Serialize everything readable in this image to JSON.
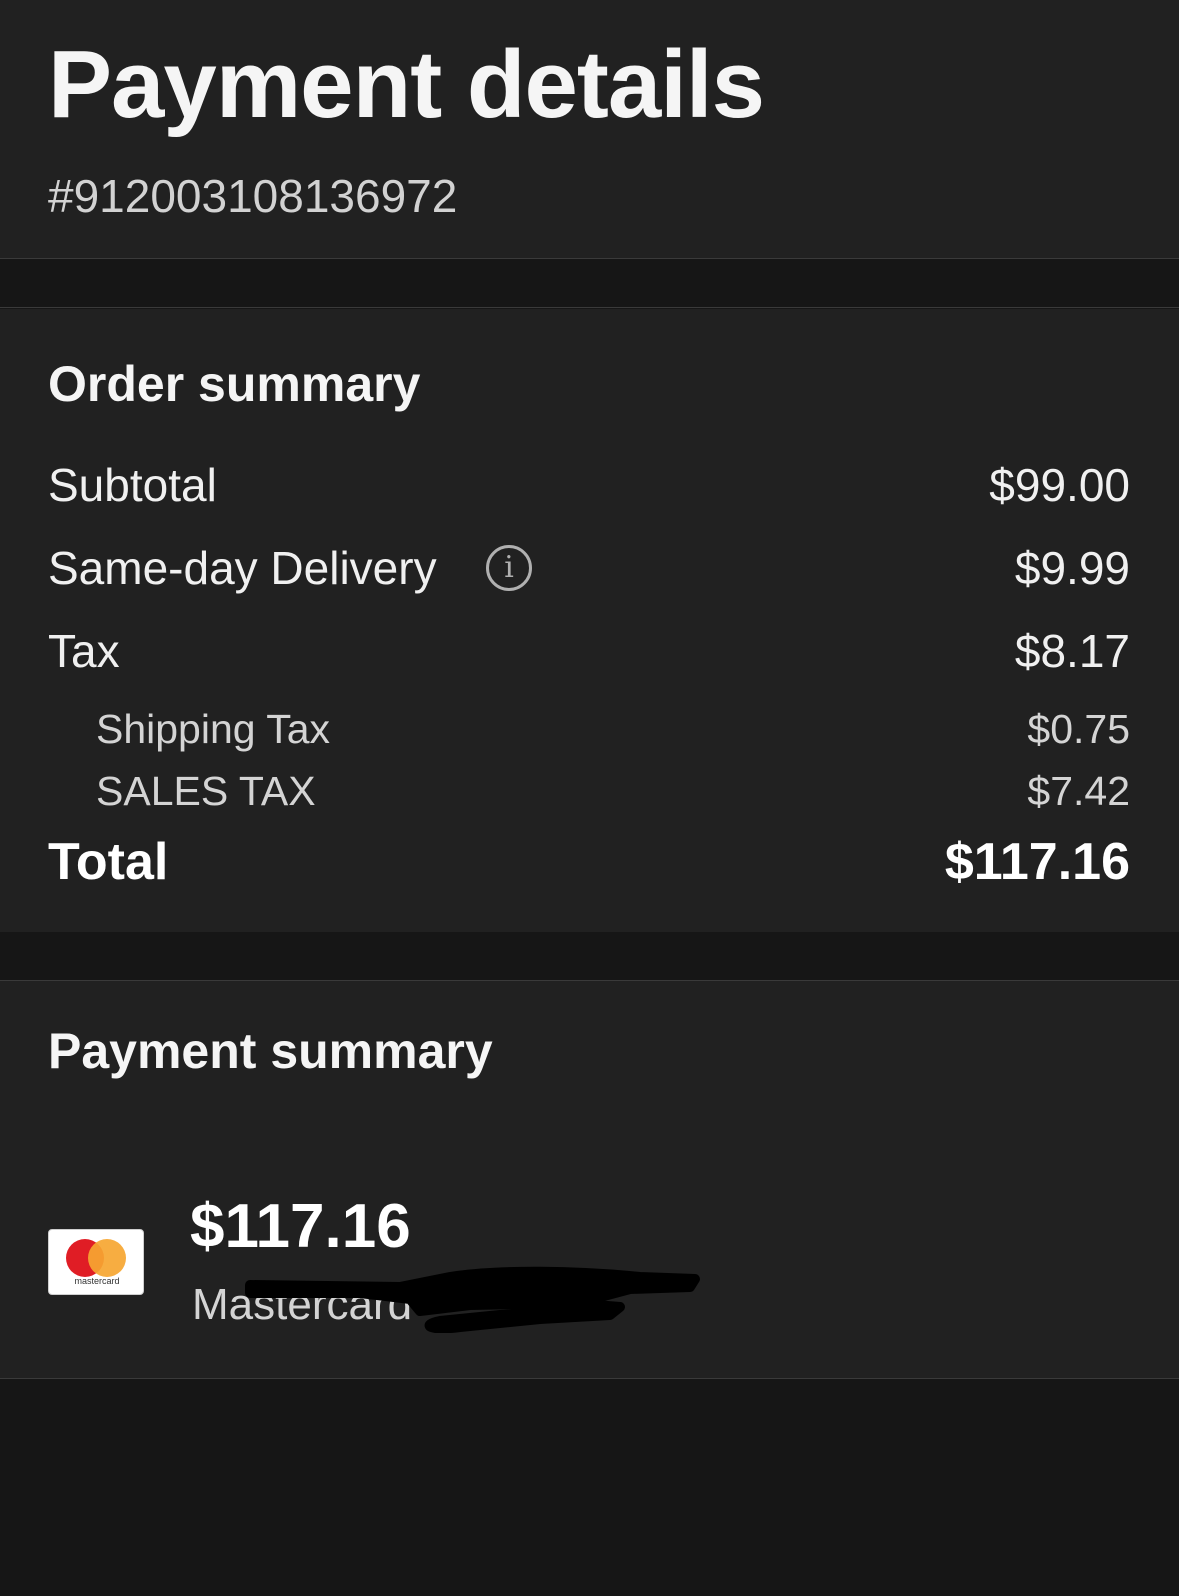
{
  "header": {
    "title": "Payment details",
    "order_number": "#912003108136972"
  },
  "order_summary": {
    "title": "Order summary",
    "subtotal": {
      "label": "Subtotal",
      "value": "$99.00"
    },
    "delivery": {
      "label": "Same-day Delivery",
      "value": "$9.99",
      "icon": "info-icon"
    },
    "tax": {
      "label": "Tax",
      "value": "$8.17"
    },
    "shipping_tax": {
      "label": "Shipping Tax",
      "value": "$0.75"
    },
    "sales_tax": {
      "label": "SALES TAX",
      "value": "$7.42"
    },
    "total": {
      "label": "Total",
      "value": "$117.16"
    }
  },
  "payment_summary": {
    "title": "Payment summary",
    "amount": "$117.16",
    "method": "Mastercard",
    "card_logo_text": "mastercard",
    "card_logo_colors": {
      "red": "#e01d25",
      "orange": "#f6a631"
    }
  },
  "colors": {
    "background": "#161616",
    "card": "#212121",
    "text": "#f2f2f2",
    "muted_text": "#d2d2d2"
  }
}
